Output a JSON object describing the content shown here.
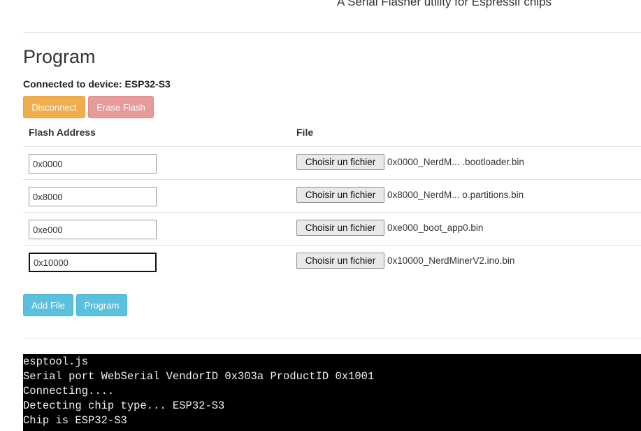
{
  "header": {
    "subtitle": "A Serial Flasher utility for Espressif chips"
  },
  "program": {
    "title": "Program",
    "connected_text": "Connected to device: ESP32-S3",
    "disconnect_label": "Disconnect",
    "erase_label": "Erase Flash",
    "table": {
      "headers": {
        "address": "Flash Address",
        "file": "File"
      },
      "rows": [
        {
          "address": "0x0000",
          "button_label": "Choisir un fichier",
          "file_name": "0x0000_NerdM... .bootloader.bin"
        },
        {
          "address": "0x8000",
          "button_label": "Choisir un fichier",
          "file_name": "0x8000_NerdM... o.partitions.bin"
        },
        {
          "address": "0xe000",
          "button_label": "Choisir un fichier",
          "file_name": "0xe000_boot_app0.bin"
        },
        {
          "address": "0x10000",
          "button_label": "Choisir un fichier",
          "file_name": "0x10000_NerdMinerV2.ino.bin"
        }
      ]
    },
    "add_file_label": "Add File",
    "program_label": "Program"
  },
  "terminal": {
    "lines": [
      "esptool.js",
      "Serial port WebSerial VendorID 0x303a ProductID 0x1001",
      "Connecting....",
      "Detecting chip type... ESP32-S3",
      "Chip is ESP32-S3"
    ]
  },
  "colors": {
    "warning": "#f0ad4e",
    "danger_light": "#e69a9a",
    "info": "#5bc0de",
    "terminal_bg": "#000000",
    "terminal_fg": "#f0f0f0"
  }
}
